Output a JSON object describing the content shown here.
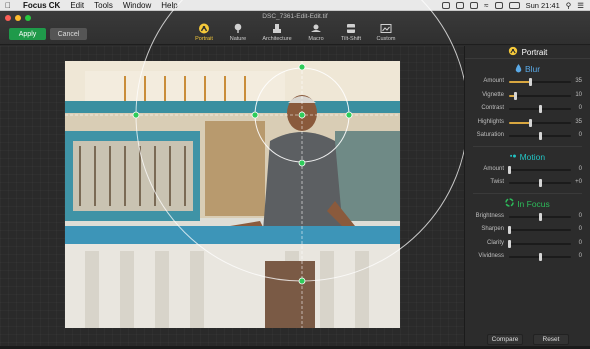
{
  "menubar": {
    "app_name": "Focus CK",
    "items": [
      "Edit",
      "Tools",
      "Window",
      "Help"
    ],
    "clock": "Sun 21:41"
  },
  "window": {
    "document_title": "DSC_7361-Edit-Edit.tif"
  },
  "toolbar": {
    "apply_label": "Apply",
    "cancel_label": "Cancel",
    "presets": [
      {
        "label": "Portrait",
        "icon": "portrait-icon",
        "active": true
      },
      {
        "label": "Nature",
        "icon": "nature-icon",
        "active": false
      },
      {
        "label": "Architecture",
        "icon": "architecture-icon",
        "active": false
      },
      {
        "label": "Macro",
        "icon": "macro-icon",
        "active": false
      },
      {
        "label": "Tilt-Shift",
        "icon": "tilt-shift-icon",
        "active": false
      },
      {
        "label": "Custom",
        "icon": "custom-icon",
        "active": false
      }
    ]
  },
  "panel": {
    "title": "Portrait",
    "blur": {
      "title": "Blur",
      "sliders": [
        {
          "label": "Amount",
          "value": "35",
          "level": 0.35
        },
        {
          "label": "Vignette",
          "value": "10",
          "level": 0.1
        },
        {
          "label": "Contrast",
          "value": "0",
          "level": 0.5
        },
        {
          "label": "Highlights",
          "value": "35",
          "level": 0.35
        },
        {
          "label": "Saturation",
          "value": "0",
          "level": 0.5
        }
      ]
    },
    "motion": {
      "title": "Motion",
      "sliders": [
        {
          "label": "Amount",
          "value": "0",
          "level": 0.0
        },
        {
          "label": "Twist",
          "value": "+0",
          "level": 0.5
        }
      ]
    },
    "in_focus": {
      "title": "In Focus",
      "sliders": [
        {
          "label": "Brightness",
          "value": "0",
          "level": 0.5
        },
        {
          "label": "Sharpen",
          "value": "0",
          "level": 0.0
        },
        {
          "label": "Clarity",
          "value": "0",
          "level": 0.0
        },
        {
          "label": "Vividness",
          "value": "0",
          "level": 0.5
        }
      ]
    },
    "compare_label": "Compare",
    "reset_label": "Reset"
  },
  "colors": {
    "accent": "#f5c93a",
    "apply_green": "#1f9a4a",
    "section_blue": "#5aa9e6",
    "section_teal": "#22c3c3",
    "section_green": "#2dbb5a",
    "handle_green": "#2ecc5a"
  }
}
